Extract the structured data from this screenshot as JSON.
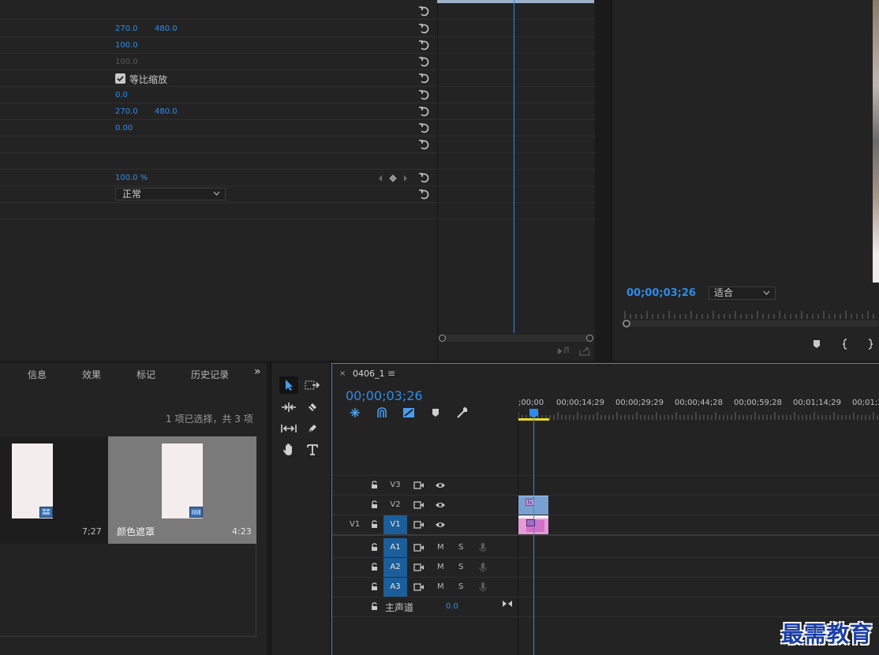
{
  "effect_controls": {
    "rows": [
      {
        "v1": "",
        "v2": ""
      },
      {
        "v1": "270.0",
        "v2": "480.0"
      },
      {
        "v1": "100.0",
        "v2": ""
      },
      {
        "v1": "100.0",
        "v2": "",
        "dim": true
      },
      {
        "checkbox": true,
        "label": "等比缩放"
      },
      {
        "v1": "0.0",
        "v2": ""
      },
      {
        "v1": "270.0",
        "v2": "480.0"
      },
      {
        "v1": "0.00",
        "v2": ""
      },
      {
        "v1": "",
        "v2": ""
      }
    ],
    "opacity_value": "100.0 %",
    "blend_mode": "正常"
  },
  "program_monitor": {
    "timecode": "00;00;03;26",
    "fit": "适合"
  },
  "project_panel": {
    "tabs": [
      "信息",
      "效果",
      "标记",
      "历史记录"
    ],
    "overflow": "»",
    "selection_status": "1 项已选择，共 3 项",
    "items": [
      {
        "name": "",
        "duration": "7;27"
      },
      {
        "name": "颜色遮罩",
        "duration": "4:23"
      }
    ]
  },
  "timeline": {
    "sequence_name": "0406_1",
    "close": "×",
    "menu": "≡",
    "timecode": "00;00;03;26",
    "ruler_labels": [
      ";00;00",
      "00;00;14;29",
      "00;00;29;29",
      "00;00;44;28",
      "00;00;59;28",
      "00;01;14;29",
      "00;01;2"
    ],
    "video_tracks": [
      "V3",
      "V2",
      "V1"
    ],
    "audio_tracks": [
      "A1",
      "A2",
      "A3"
    ],
    "source_patch": "V1",
    "mute_label": "M",
    "solo_label": "S",
    "master_label": "主声道",
    "master_value": "0.0"
  },
  "watermark": "最需教育",
  "colors": {
    "accent": "#2d8ceb",
    "track_on": "#1c5e9a",
    "workarea": "#e3d82e"
  }
}
